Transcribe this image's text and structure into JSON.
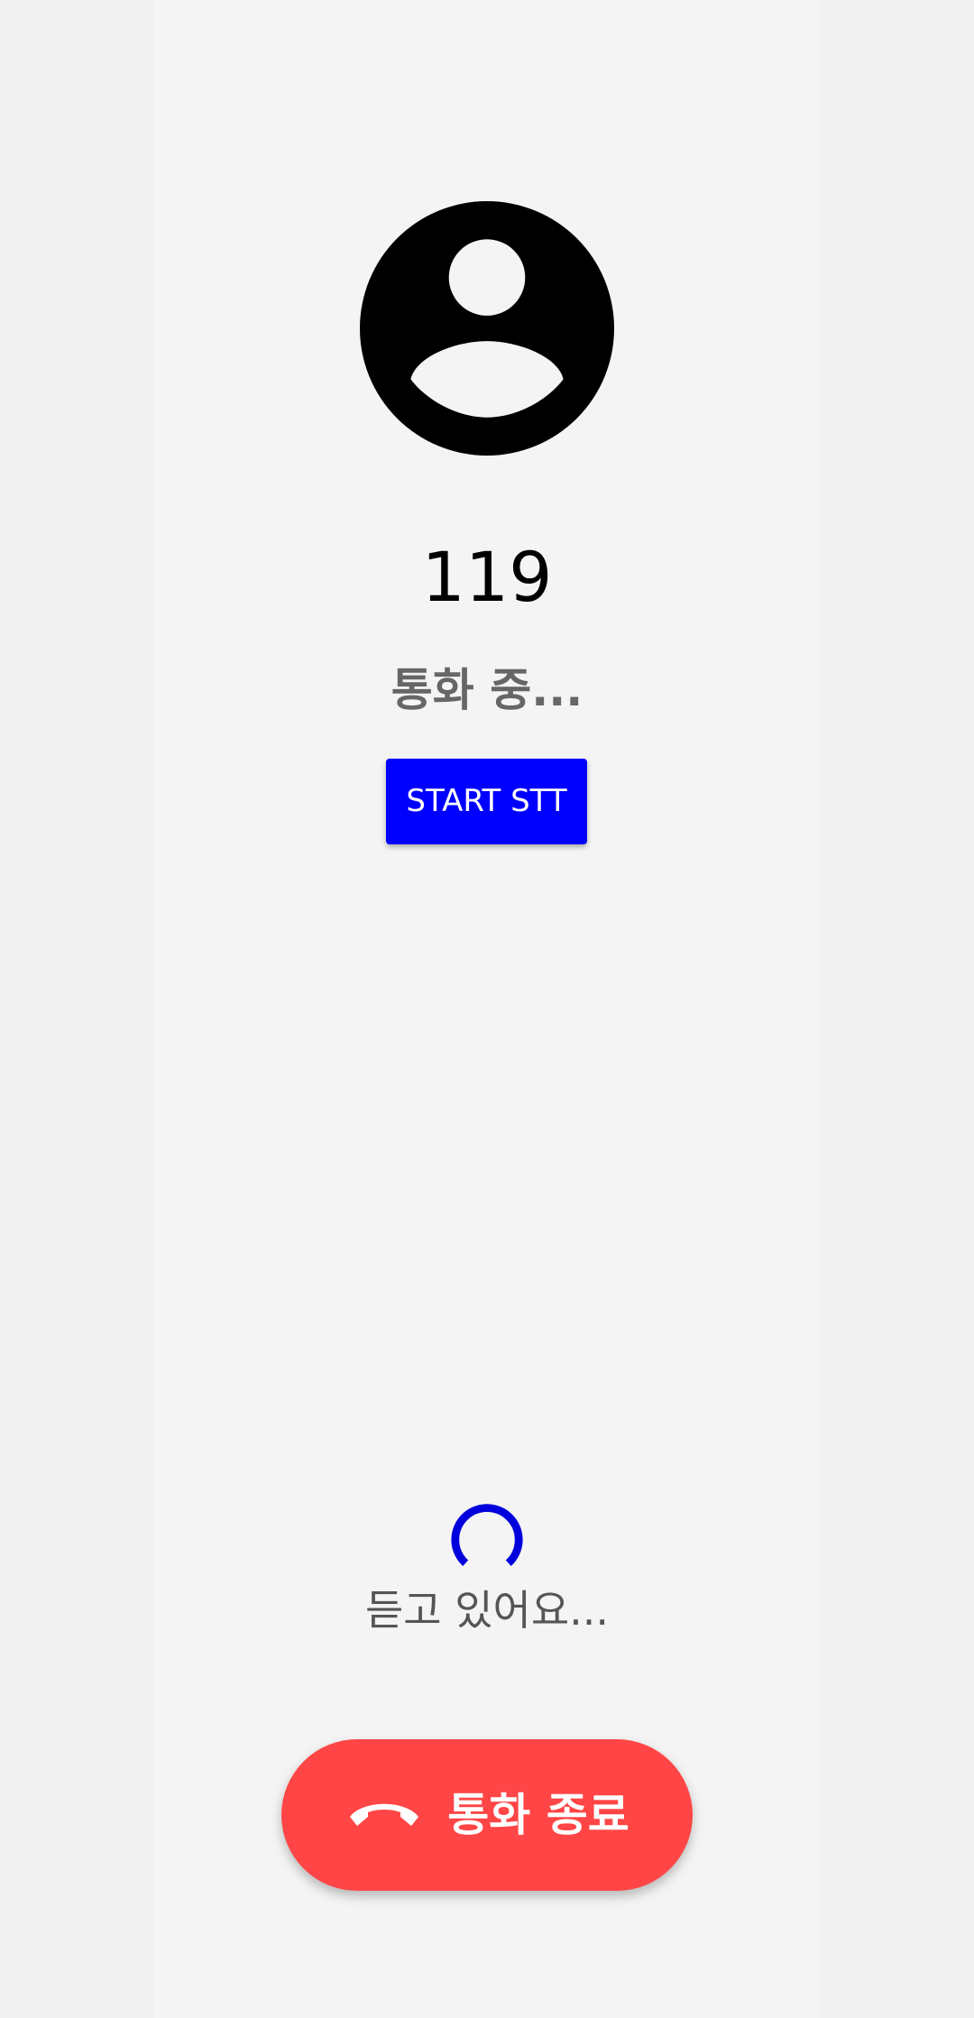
{
  "colors": {
    "page_background": "#f1f1f1",
    "panel_background": "#f4f4f4",
    "stt_button": "#0000ff",
    "end_call_button": "#ff4545",
    "spinner": "#0000dd"
  },
  "caller": {
    "avatar_icon": "account-circle-icon",
    "number": "119",
    "status": "통화 중..."
  },
  "stt": {
    "button_label": "START STT"
  },
  "listening": {
    "spinner_icon": "loading-spinner-icon",
    "text": "듣고 있어요..."
  },
  "end_call": {
    "icon": "call-end-icon",
    "label": "통화 종료"
  }
}
